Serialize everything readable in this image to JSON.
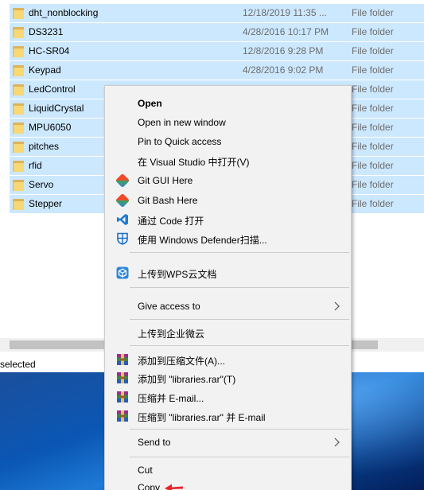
{
  "files": [
    {
      "name": "dht_nonblocking",
      "date": "12/18/2019 11:35 ...",
      "type": "File folder"
    },
    {
      "name": "DS3231",
      "date": "4/28/2016 10:17 PM",
      "type": "File folder"
    },
    {
      "name": "HC-SR04",
      "date": "12/8/2016 9:28 PM",
      "type": "File folder"
    },
    {
      "name": "Keypad",
      "date": "4/28/2016 9:02 PM",
      "type": "File folder"
    },
    {
      "name": "LedControl",
      "date": "",
      "type": "File folder"
    },
    {
      "name": "LiquidCrystal",
      "date": "",
      "type": "File folder"
    },
    {
      "name": "MPU6050",
      "date": "",
      "type": "File folder"
    },
    {
      "name": "pitches",
      "date": "",
      "type": "File folder"
    },
    {
      "name": "rfid",
      "date": "",
      "type": "File folder"
    },
    {
      "name": "Servo",
      "date": "",
      "type": "File folder"
    },
    {
      "name": "Stepper",
      "date": "",
      "type": "File folder"
    }
  ],
  "status": {
    "text": "selected"
  },
  "menu": {
    "open": "Open",
    "open_new_window": "Open in new window",
    "pin_quick_access": "Pin to Quick access",
    "open_visual_studio": "在 Visual Studio 中打开(V)",
    "git_gui": "Git GUI Here",
    "git_bash": "Git Bash Here",
    "open_code": "通过 Code 打开",
    "defender_scan": "使用 Windows Defender扫描...",
    "upload_wps": "上传到WPS云文档",
    "give_access": "Give access to",
    "upload_enterprise": "上传到企业微云",
    "add_archive": "添加到压缩文件(A)...",
    "add_libraries_rar": "添加到 \"libraries.rar\"(T)",
    "compress_email": "压缩并 E-mail...",
    "compress_rar_email": "压缩到 \"libraries.rar\" 并 E-mail",
    "send_to": "Send to",
    "cut": "Cut",
    "copy": "Copy"
  },
  "colors": {
    "selection": "#cce8ff",
    "menu_bg": "#f2f2f2",
    "annotation_arrow": "#e8262c"
  },
  "icons": {
    "git_gui": "git-icon",
    "git_bash": "git-icon",
    "open_code": "vscode-icon",
    "defender_scan": "shield-icon",
    "upload_wps": "cloud-box-icon",
    "winrar": "winrar-icon"
  }
}
